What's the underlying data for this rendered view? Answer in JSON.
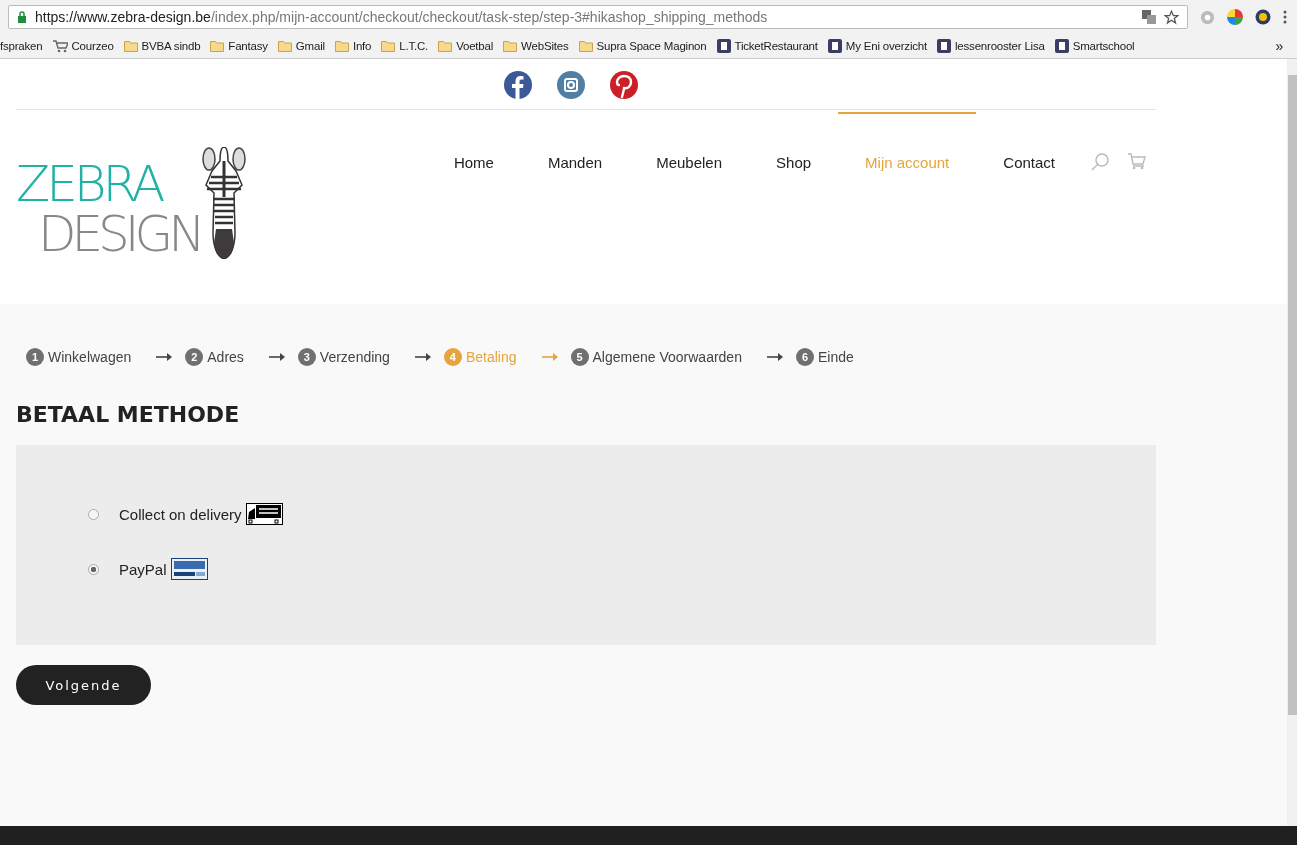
{
  "browser": {
    "url_host": "https://www.zebra-design.be",
    "url_path": "/index.php/mijn-account/checkout/checkout/task-step/step-3#hikashop_shipping_methods",
    "bookmarks": [
      {
        "label": "fspraken",
        "kind": "none"
      },
      {
        "label": "Courzeo",
        "kind": "cart"
      },
      {
        "label": "BVBA sindb",
        "kind": "folder"
      },
      {
        "label": "Fantasy",
        "kind": "folder"
      },
      {
        "label": "Gmail",
        "kind": "folder"
      },
      {
        "label": "Info",
        "kind": "folder"
      },
      {
        "label": "L.T.C.",
        "kind": "folder"
      },
      {
        "label": "Voetbal",
        "kind": "folder"
      },
      {
        "label": "WebSites",
        "kind": "folder"
      },
      {
        "label": "Supra Space Maginon",
        "kind": "folder"
      },
      {
        "label": "TicketRestaurant",
        "kind": "site"
      },
      {
        "label": "My Eni overzicht",
        "kind": "site"
      },
      {
        "label": "lessenrooster Lisa",
        "kind": "site"
      },
      {
        "label": "Smartschool",
        "kind": "site"
      }
    ],
    "more": "»"
  },
  "logo": {
    "line_1": "ZEBRA",
    "line_2": "DESIGN"
  },
  "nav": [
    {
      "label": "Home",
      "selected": false
    },
    {
      "label": "Manden",
      "selected": false
    },
    {
      "label": "Meubelen",
      "selected": false
    },
    {
      "label": "Shop",
      "selected": false
    },
    {
      "label": "Mijn account",
      "selected": true
    },
    {
      "label": "Contact",
      "selected": false
    }
  ],
  "steps": [
    {
      "number": "1",
      "label": "Winkelwagen",
      "selected": false
    },
    {
      "number": "2",
      "label": "Adres",
      "selected": false
    },
    {
      "number": "3",
      "label": "Verzending",
      "selected": false
    },
    {
      "number": "4",
      "label": "Betaling",
      "selected": true
    },
    {
      "number": "5",
      "label": "Algemene Voorwaarden",
      "selected": false
    },
    {
      "number": "6",
      "label": "Einde",
      "selected": false
    }
  ],
  "heading": "BETAAL METHODE",
  "methods": [
    {
      "label": "Collect on delivery",
      "kind": "truck",
      "selected": false
    },
    {
      "label": "PayPal",
      "kind": "paypal",
      "selected": true
    }
  ],
  "next_button": "Volgende"
}
